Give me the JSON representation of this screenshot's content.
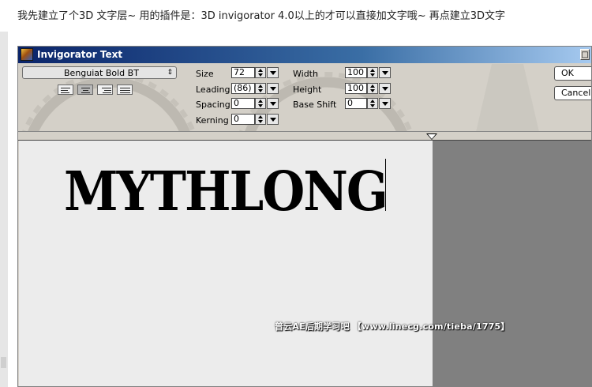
{
  "caption": "我先建立了个3D 文字层~ 用的插件是：3D invigorator 4.0以上的才可以直接加文字哦~ 再点建立3D文字",
  "window": {
    "title": "Invigorator Text",
    "close_glyph": "□"
  },
  "font_selector": {
    "value": "Benguiat Bold BT",
    "arrow": "⇕"
  },
  "params_left": [
    {
      "label": "Size",
      "value": "72"
    },
    {
      "label": "Leading",
      "value": "(86)"
    },
    {
      "label": "Spacing",
      "value": "0"
    },
    {
      "label": "Kerning",
      "value": "0"
    }
  ],
  "params_right": [
    {
      "label": "Width",
      "value": "100"
    },
    {
      "label": "Height",
      "value": "100"
    },
    {
      "label": "Base Shift",
      "value": "0"
    }
  ],
  "buttons": {
    "ok": "OK",
    "cancel": "Cancel"
  },
  "canvas_text": "MYTHLONG",
  "watermark": "普云AE后期学习吧 【www.linecg.com/tieba/1775】",
  "colors": {
    "titlebar_start": "#0a246a",
    "titlebar_end": "#a6caf0",
    "panel": "#d4d0c8",
    "canvas": "#ececec",
    "outside_canvas": "#808080"
  }
}
